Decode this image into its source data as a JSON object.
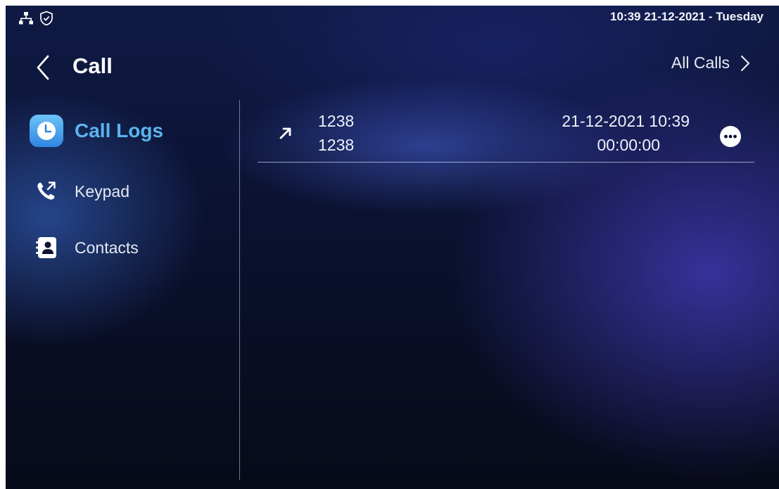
{
  "status_bar": {
    "datetime": "10:39  21-12-2021 - Tuesday",
    "icons": [
      "network-icon",
      "shield-check-icon"
    ]
  },
  "header": {
    "title": "Call",
    "back_icon": "chevron-left-icon",
    "all_calls_label": "All Calls",
    "all_calls_icon": "chevron-right-icon"
  },
  "sidebar": {
    "items": [
      {
        "label": "Call Logs",
        "icon": "clock-icon",
        "active": true
      },
      {
        "label": "Keypad",
        "icon": "phone-outgoing-icon",
        "active": false
      },
      {
        "label": "Contacts",
        "icon": "contact-book-icon",
        "active": false
      }
    ]
  },
  "call_logs": [
    {
      "direction_icon": "outgoing-arrow-icon",
      "name": "1238",
      "number": "1238",
      "datetime": "21-12-2021 10:39",
      "duration": "00:00:00",
      "more_icon": "more-options-icon"
    }
  ],
  "colors": {
    "accent": "#5cb4f0",
    "background_dark": "#070a18",
    "background_blue": "#3c3cb4",
    "text": "#ffffff"
  }
}
